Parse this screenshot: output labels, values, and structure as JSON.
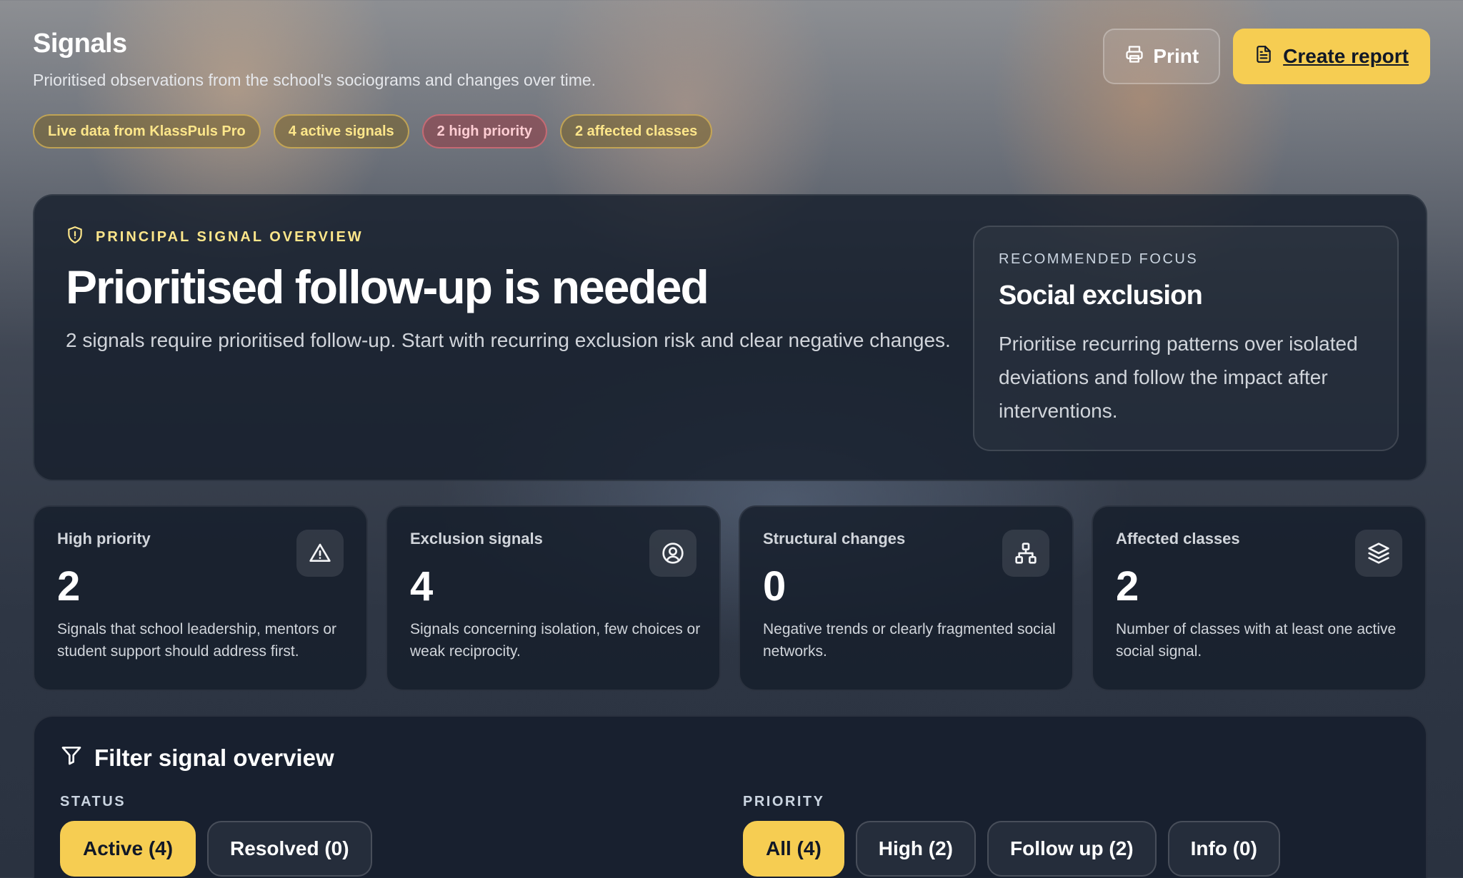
{
  "header": {
    "title": "Signals",
    "subtitle": "Prioritised observations from the school's sociograms and changes over time.",
    "chips": [
      {
        "label": "Live data from KlassPuls Pro",
        "tone": "gold"
      },
      {
        "label": "4 active signals",
        "tone": "gold"
      },
      {
        "label": "2 high priority",
        "tone": "red"
      },
      {
        "label": "2 affected classes",
        "tone": "gold"
      }
    ],
    "print_label": "Print",
    "report_label": "Create report"
  },
  "hero": {
    "eyebrow": "PRINCIPAL SIGNAL OVERVIEW",
    "title": "Prioritised follow-up is needed",
    "text": "2 signals require prioritised follow-up. Start with recurring exclusion risk and clear negative changes.",
    "focus": {
      "label": "RECOMMENDED FOCUS",
      "title": "Social exclusion",
      "text": "Prioritise recurring patterns over isolated deviations and follow the impact after interventions."
    }
  },
  "stats": [
    {
      "label": "High priority",
      "value": "2",
      "desc": "Signals that school leadership, mentors or student support should address first.",
      "icon": "warning-icon"
    },
    {
      "label": "Exclusion signals",
      "value": "4",
      "desc": "Signals concerning isolation, few choices or weak reciprocity.",
      "icon": "user-circle-icon"
    },
    {
      "label": "Structural changes",
      "value": "0",
      "desc": "Negative trends or clearly fragmented social networks.",
      "icon": "network-icon"
    },
    {
      "label": "Affected classes",
      "value": "2",
      "desc": "Number of classes with at least one active social signal.",
      "icon": "layers-icon"
    }
  ],
  "filters": {
    "title": "Filter signal overview",
    "status": {
      "label": "STATUS",
      "options": [
        {
          "label": "Active (4)",
          "selected": true
        },
        {
          "label": "Resolved (0)",
          "selected": false
        }
      ]
    },
    "priority": {
      "label": "PRIORITY",
      "options": [
        {
          "label": "All (4)",
          "selected": true
        },
        {
          "label": "High (2)",
          "selected": false
        },
        {
          "label": "Follow up (2)",
          "selected": false
        },
        {
          "label": "Info (0)",
          "selected": false
        }
      ]
    }
  },
  "colors": {
    "accent": "#f6cd52",
    "card": "#161e2c",
    "chip_gold_text": "#fde68a",
    "chip_red_text": "#fecdd3"
  }
}
